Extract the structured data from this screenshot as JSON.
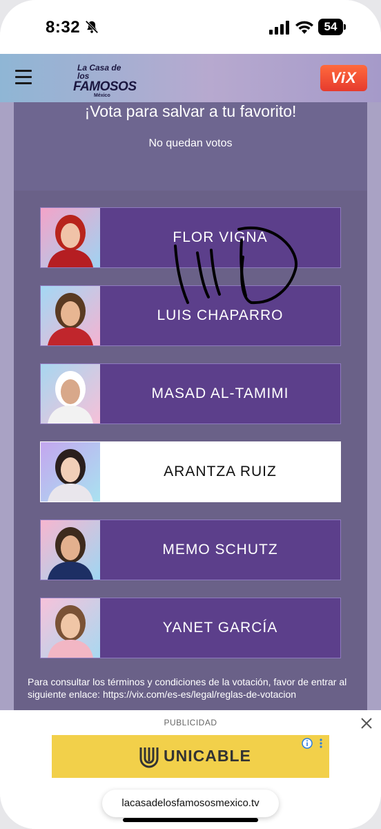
{
  "status_bar": {
    "time": "8:32",
    "battery": "54"
  },
  "header": {
    "logo_line1": "La Casa de los",
    "logo_line2": "FAMOSOS",
    "logo_line3": "México",
    "brand": "ViX"
  },
  "vote": {
    "title": "¡Vota para salvar a tu favorito!",
    "subtitle": "No quedan votos"
  },
  "candidates": [
    {
      "name": "FLOR VIGNA",
      "hair": "#b8241c",
      "skin": "#f0c3a8",
      "bg1": "#f4a3c8",
      "bg2": "#9fd3f2",
      "shirt": "#b51e22",
      "selected": false
    },
    {
      "name": "LUIS CHAPARRO",
      "hair": "#5a3a22",
      "skin": "#e8b692",
      "bg1": "#a3d8f4",
      "bg2": "#f4b3d1",
      "shirt": "#c0262c",
      "selected": false
    },
    {
      "name": "MASAD AL-TAMIMI",
      "hair": "#ffffff",
      "skin": "#d8a88a",
      "bg1": "#a7d7f0",
      "bg2": "#f6c0d8",
      "shirt": "#f2f2f2",
      "selected": false
    },
    {
      "name": "ARANTZA RUIZ",
      "hair": "#2a1f1d",
      "skin": "#f1cfb8",
      "bg1": "#c3a6ef",
      "bg2": "#a9e2f0",
      "shirt": "#e9e6ec",
      "selected": true
    },
    {
      "name": "MEMO SCHUTZ",
      "hair": "#3d2a1d",
      "skin": "#e3b08e",
      "bg1": "#f7b6cf",
      "bg2": "#9fd6f2",
      "shirt": "#1d2f64",
      "selected": false
    },
    {
      "name": "YANET GARCÍA",
      "hair": "#7a5236",
      "skin": "#f0c6a6",
      "bg1": "#f7c2da",
      "bg2": "#a8d8f0",
      "shirt": "#f2b6c4",
      "selected": false
    }
  ],
  "terms": {
    "text": "Para consultar los términos y condiciones de la votación, favor de entrar al siguiente enlace: https://vix.com/es-es/legal/reglas-de-votacion"
  },
  "ad": {
    "label": "PUBLICIDAD",
    "brand": "UNICABLE"
  },
  "browser": {
    "url": "lacasadelosfamososmexico.tv"
  }
}
